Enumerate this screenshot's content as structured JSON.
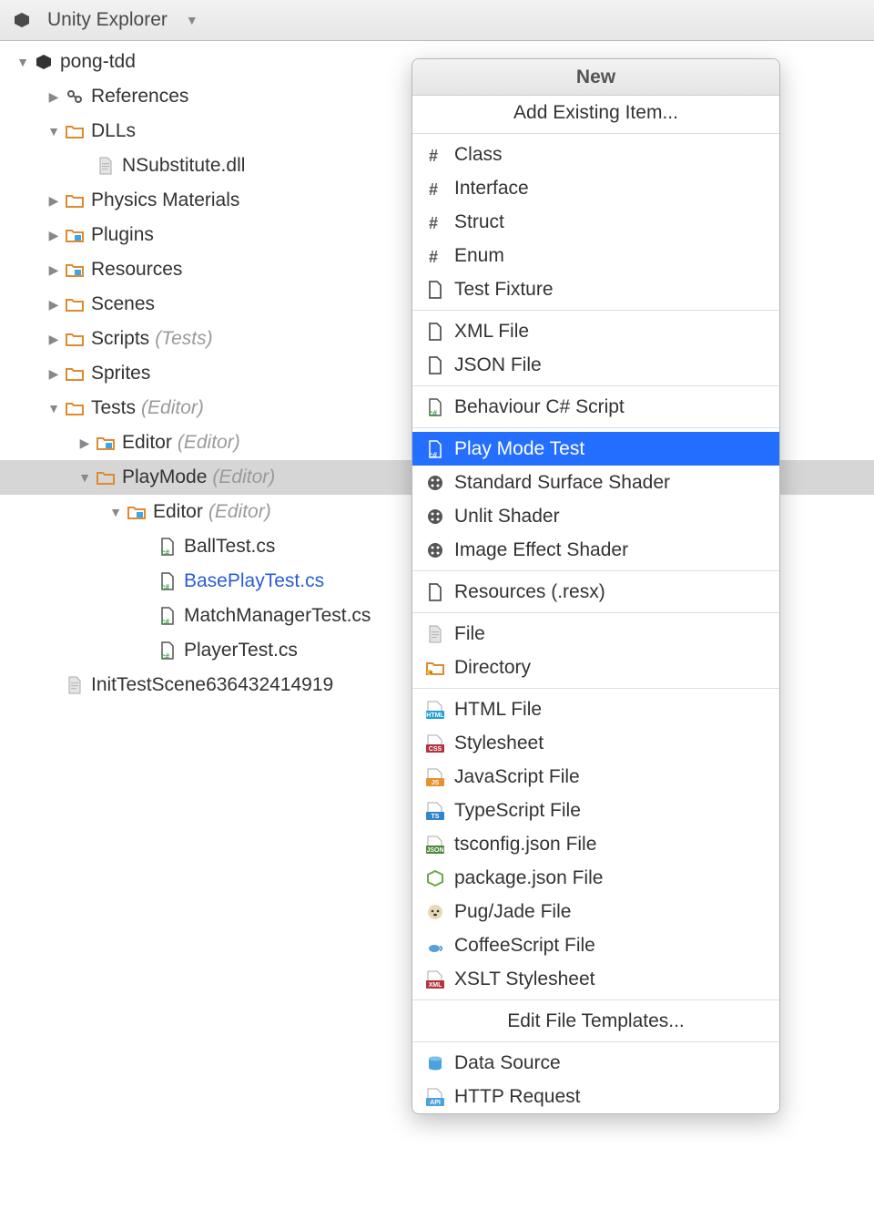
{
  "toolbar": {
    "title": "Unity Explorer"
  },
  "tree": [
    {
      "depth": 0,
      "disclosure": "down",
      "icon": "unity",
      "label": "pong-tdd"
    },
    {
      "depth": 1,
      "disclosure": "right",
      "icon": "refs",
      "label": "References"
    },
    {
      "depth": 1,
      "disclosure": "down",
      "icon": "folder",
      "label": "DLLs"
    },
    {
      "depth": 2,
      "disclosure": "",
      "icon": "file-gray",
      "label": "NSubstitute.dll"
    },
    {
      "depth": 1,
      "disclosure": "right",
      "icon": "folder",
      "label": "Physics Materials"
    },
    {
      "depth": 1,
      "disclosure": "right",
      "icon": "folder-blue",
      "label": "Plugins"
    },
    {
      "depth": 1,
      "disclosure": "right",
      "icon": "folder-blue",
      "label": "Resources"
    },
    {
      "depth": 1,
      "disclosure": "right",
      "icon": "folder",
      "label": "Scenes"
    },
    {
      "depth": 1,
      "disclosure": "right",
      "icon": "folder",
      "label": "Scripts",
      "suffix": "(Tests)"
    },
    {
      "depth": 1,
      "disclosure": "right",
      "icon": "folder",
      "label": "Sprites"
    },
    {
      "depth": 1,
      "disclosure": "down",
      "icon": "folder",
      "label": "Tests",
      "suffix": "(Editor)"
    },
    {
      "depth": 2,
      "disclosure": "right",
      "icon": "folder-blue",
      "label": "Editor",
      "suffix": "(Editor)"
    },
    {
      "depth": 2,
      "disclosure": "down",
      "icon": "folder",
      "label": "PlayMode",
      "suffix": "(Editor)",
      "selected": true
    },
    {
      "depth": 3,
      "disclosure": "down",
      "icon": "folder-blue",
      "label": "Editor",
      "suffix": "(Editor)"
    },
    {
      "depth": 4,
      "disclosure": "",
      "icon": "cs",
      "label": "BallTest.cs"
    },
    {
      "depth": 4,
      "disclosure": "",
      "icon": "cs",
      "label": "BasePlayTest.cs",
      "blue": true
    },
    {
      "depth": 4,
      "disclosure": "",
      "icon": "cs",
      "label": "MatchManagerTest.cs"
    },
    {
      "depth": 4,
      "disclosure": "",
      "icon": "cs",
      "label": "PlayerTest.cs"
    },
    {
      "depth": 1,
      "disclosure": "",
      "icon": "file-gray",
      "label": "InitTestScene636432414919"
    }
  ],
  "menu": {
    "title": "New",
    "groups": [
      [
        {
          "label": "Add Existing Item...",
          "center": true
        }
      ],
      [
        {
          "icon": "hash",
          "label": "Class"
        },
        {
          "icon": "hash",
          "label": "Interface"
        },
        {
          "icon": "hash",
          "label": "Struct"
        },
        {
          "icon": "hash",
          "label": "Enum"
        },
        {
          "icon": "doc",
          "label": "Test Fixture"
        }
      ],
      [
        {
          "icon": "doc",
          "label": "XML File"
        },
        {
          "icon": "doc",
          "label": "JSON File"
        }
      ],
      [
        {
          "icon": "cs",
          "label": "Behaviour C# Script"
        }
      ],
      [
        {
          "icon": "cs",
          "label": "Play Mode Test",
          "highlight": true
        },
        {
          "icon": "shader",
          "label": "Standard Surface Shader"
        },
        {
          "icon": "shader",
          "label": "Unlit Shader"
        },
        {
          "icon": "shader",
          "label": "Image Effect Shader"
        }
      ],
      [
        {
          "icon": "doc",
          "label": "Resources (.resx)"
        }
      ],
      [
        {
          "icon": "file-gray",
          "label": "File"
        },
        {
          "icon": "newdir",
          "label": "Directory"
        }
      ],
      [
        {
          "icon": "html",
          "label": "HTML File"
        },
        {
          "icon": "css",
          "label": "Stylesheet"
        },
        {
          "icon": "js",
          "label": "JavaScript File"
        },
        {
          "icon": "ts",
          "label": "TypeScript File"
        },
        {
          "icon": "json",
          "label": "tsconfig.json File"
        },
        {
          "icon": "node",
          "label": "package.json File"
        },
        {
          "icon": "pug",
          "label": "Pug/Jade File"
        },
        {
          "icon": "coffee",
          "label": "CoffeeScript File"
        },
        {
          "icon": "xml",
          "label": "XSLT Stylesheet"
        }
      ],
      [
        {
          "label": "Edit File Templates...",
          "center": true
        }
      ],
      [
        {
          "icon": "db",
          "label": "Data Source"
        },
        {
          "icon": "api",
          "label": "HTTP Request"
        }
      ]
    ]
  }
}
